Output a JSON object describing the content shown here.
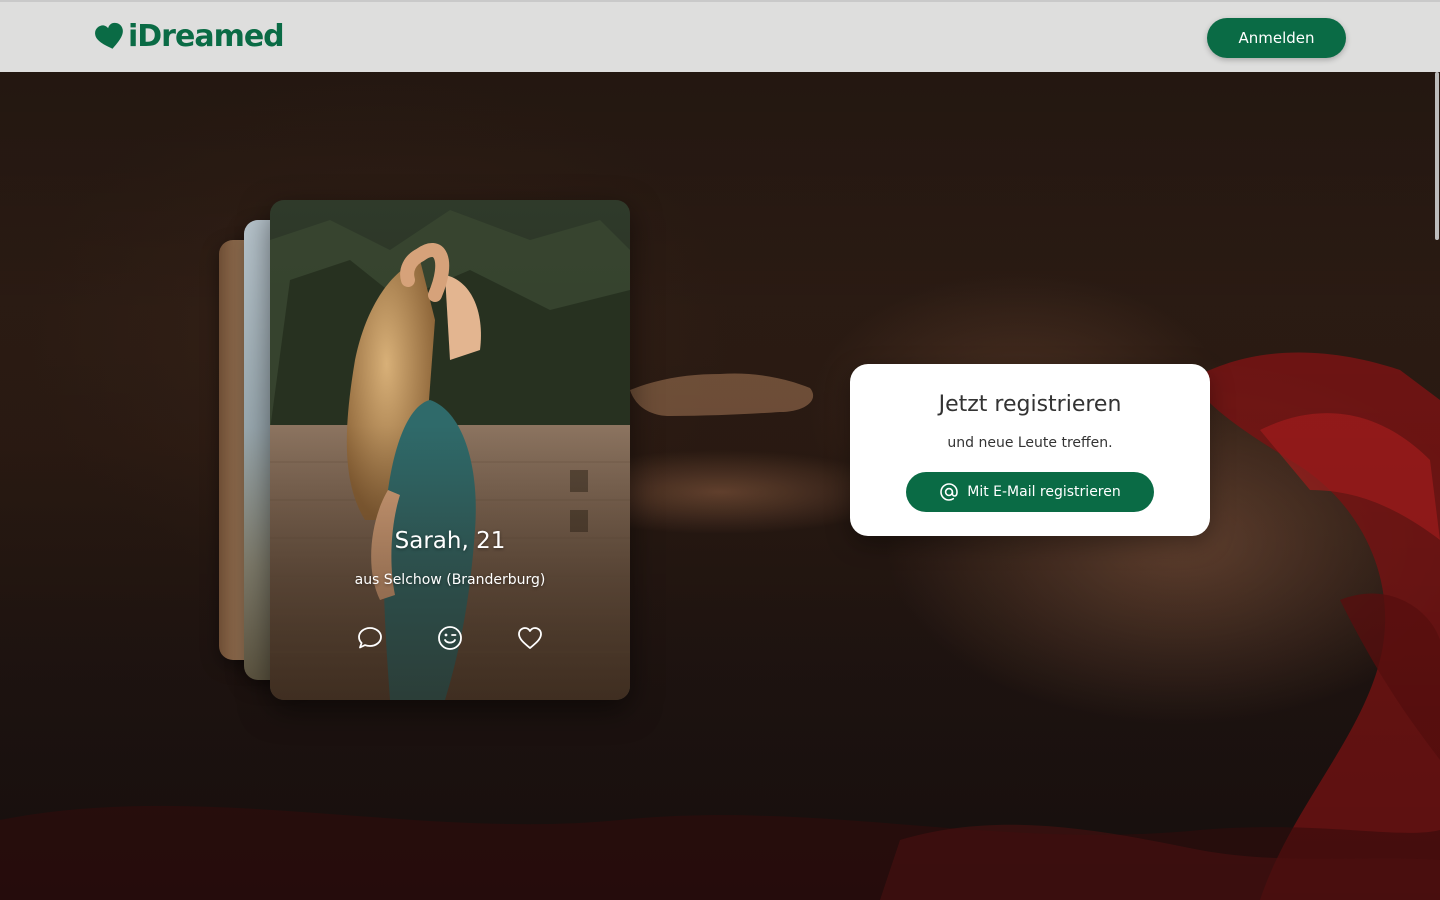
{
  "header": {
    "logo_text": "iDreamed",
    "login_label": "Anmelden"
  },
  "profile_card": {
    "name_age": "Sarah, 21",
    "location": "aus Selchow (Branderburg)",
    "actions": [
      {
        "icon": "chat-bubble-icon"
      },
      {
        "icon": "wink-smiley-icon"
      },
      {
        "icon": "heart-icon"
      }
    ]
  },
  "registration": {
    "title": "Jetzt registrieren",
    "subtitle": "und neue Leute treffen.",
    "email_button_label": "Mit E-Mail registrieren",
    "email_button_icon": "at-sign-icon"
  },
  "colors": {
    "brand_green": "#0a6b45",
    "header_bg": "#dededd"
  }
}
